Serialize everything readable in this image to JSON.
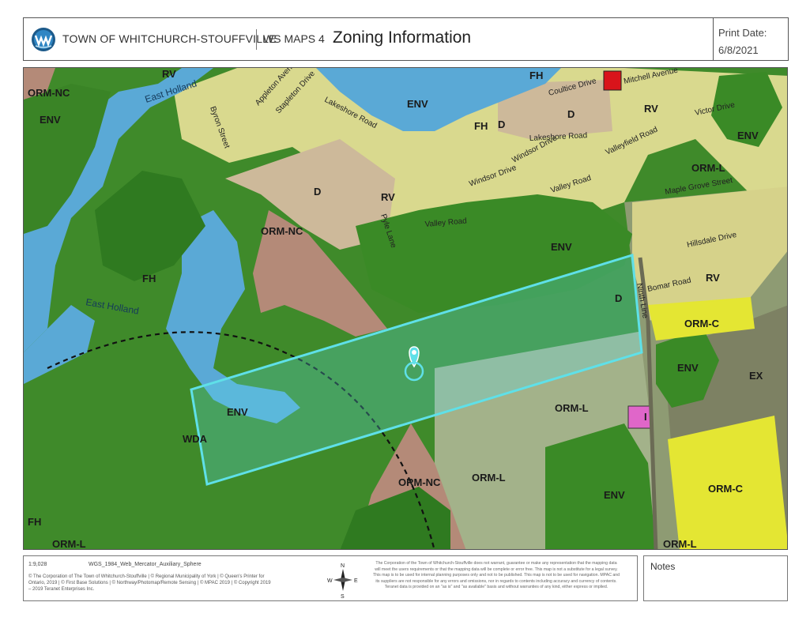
{
  "header": {
    "org": "TOWN OF WHITCHURCH-STOUFFVILLE",
    "app": "WS MAPS 4",
    "title": "Zoning Information",
    "print_label": "Print Date:",
    "print_date": "6/8/2021"
  },
  "map": {
    "zones": {
      "orm_nc_1": "ORM-NC",
      "env_1": "ENV",
      "rv_1": "RV",
      "fh_1": "FH",
      "env_2": "ENV",
      "fh_2": "FH",
      "d_1": "D",
      "d_2": "D",
      "rv_2": "RV",
      "env_3": "ENV",
      "orm_l_1": "ORM-L",
      "orm_nc_2": "ORM-NC",
      "fh_3": "FH",
      "env_4": "ENV",
      "d_3": "D",
      "rv_3": "RV",
      "orm_c_1": "ORM-C",
      "env_5": "ENV",
      "ex": "EX",
      "env_6": "ENV",
      "wda": "WDA",
      "orm_l_2": "ORM-L",
      "i": "I",
      "orm_nc_3": "ORM-NC",
      "orm_l_3": "ORM-L",
      "env_7": "ENV",
      "orm_c_2": "ORM-C",
      "fh_4": "FH",
      "orm_l_4": "ORM-L",
      "orm_l_5": "ORM-L"
    },
    "water": {
      "east_holland_1": "East Holland",
      "east_holland_2": "East Holland"
    },
    "roads": {
      "byron": "Byron Street",
      "appleton": "Appleton Avenue",
      "stapleton": "Stapleton Drive",
      "lakeshore_1": "Lakeshore Road",
      "lakeshore_2": "Lakeshore Road",
      "coultice": "Coultice Drive",
      "mitchell": "Mitchell Avenue",
      "victor": "Victor Drive",
      "windsor_1": "Windsor Drive",
      "windsor_2": "Windsor Drive",
      "valleyfield": "Valleyfield Road",
      "valley_1": "Valley Road",
      "valley_2": "Valley Road",
      "pyle": "Pyle Lane",
      "hillsdale": "Hillsdale Drive",
      "bomar": "Bomar Road",
      "ninth": "Ninth Line",
      "maple": "Maple Grove Street"
    }
  },
  "footer": {
    "scale": "1:9,028",
    "projection": "WGS_1984_Web_Mercator_Auxiliary_Sphere",
    "credits_1": "© The Corporation of The Town of Whitchurch-Stouffville | © Regional Municipality of York | © Queen's Printer for",
    "credits_2": "Ontario, 2019 | © First Base Solutions | © Northway/Photomap/Remote Sensing | © MPAC 2019 | © Copyright 2019",
    "credits_3": "– 2019 Teranet Enterprises Inc.",
    "compass": {
      "n": "N",
      "s": "S",
      "e": "E",
      "w": "W"
    },
    "disclaimer_1": "The Corporation of the Town of Whitchurch-Stouffville does not warrant, guarantee or make any representation that the mapping data",
    "disclaimer_2": "will meet the users requirements or that the mapping data will be complete or error free. This map is not a substitute for a legal survey.",
    "disclaimer_3": "This map is to be used for internal planning purposes only and not to be published. This map is not to be used for navigation. MPAC and",
    "disclaimer_4": "its suppliers are not responsible for any errors and omissions, nor in regards to contents including accuracy and currency of contents.",
    "disclaimer_5": "Teranet data is provided on an \"as is\" and \"as available\" basis and without warranties of any kind, either express or implied."
  },
  "notes": {
    "label": "Notes"
  },
  "colors": {
    "env": "#3f8a2a",
    "env_dark": "#2e6e1f",
    "water": "#5aa9d6",
    "residential": "#d9d98e",
    "development": "#cdb99a",
    "orm_nc": "#b48a78",
    "orm_l": "#a3b28a",
    "orm_c": "#e4e633",
    "institutional": "#e066c9",
    "highlight": "#5fe0e8",
    "red_parcel": "#d9141b"
  }
}
